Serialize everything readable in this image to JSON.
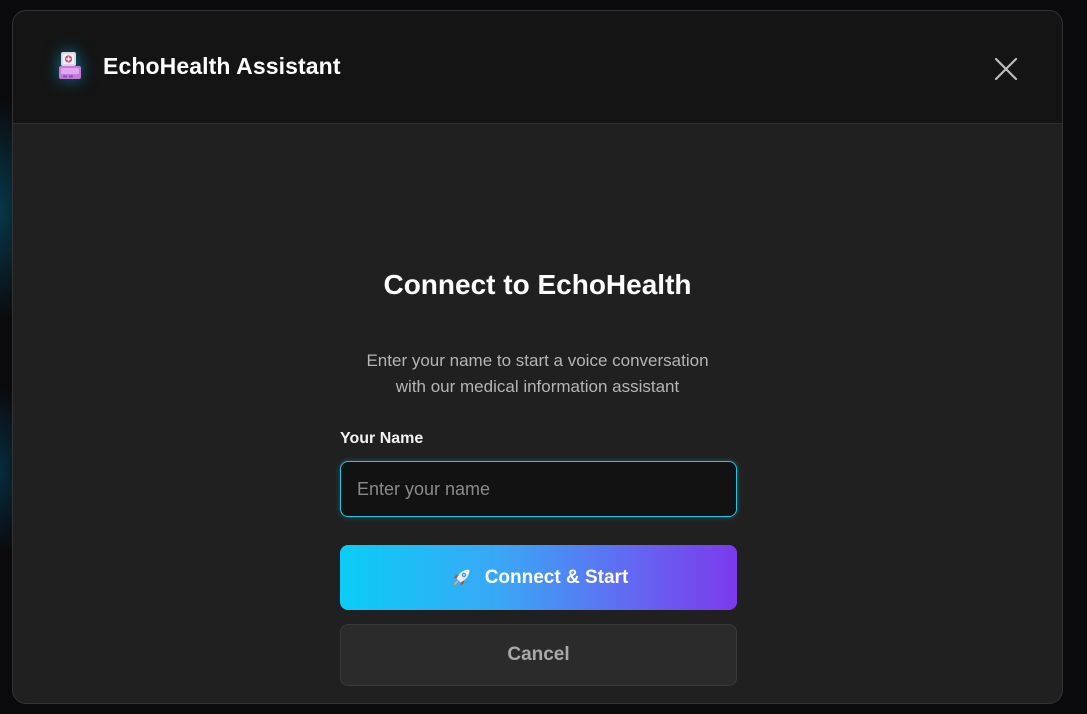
{
  "app": {
    "title": "EchoHealth Assistant",
    "icon": "medical-kiosk-icon"
  },
  "header": {
    "close_icon": "close-icon"
  },
  "form": {
    "heading": "Connect to EchoHealth",
    "subtitle_line1": "Enter your name to start a voice conversation",
    "subtitle_line2": "with our medical information assistant",
    "name_label": "Your Name",
    "name_placeholder": "Enter your name",
    "name_value": "",
    "connect_label": "Connect & Start",
    "connect_icon": "rocket-icon",
    "cancel_label": "Cancel"
  },
  "colors": {
    "accent_cyan": "#0acdf7",
    "accent_purple": "#7c3aed",
    "background": "#202020",
    "header_background": "#141414"
  }
}
